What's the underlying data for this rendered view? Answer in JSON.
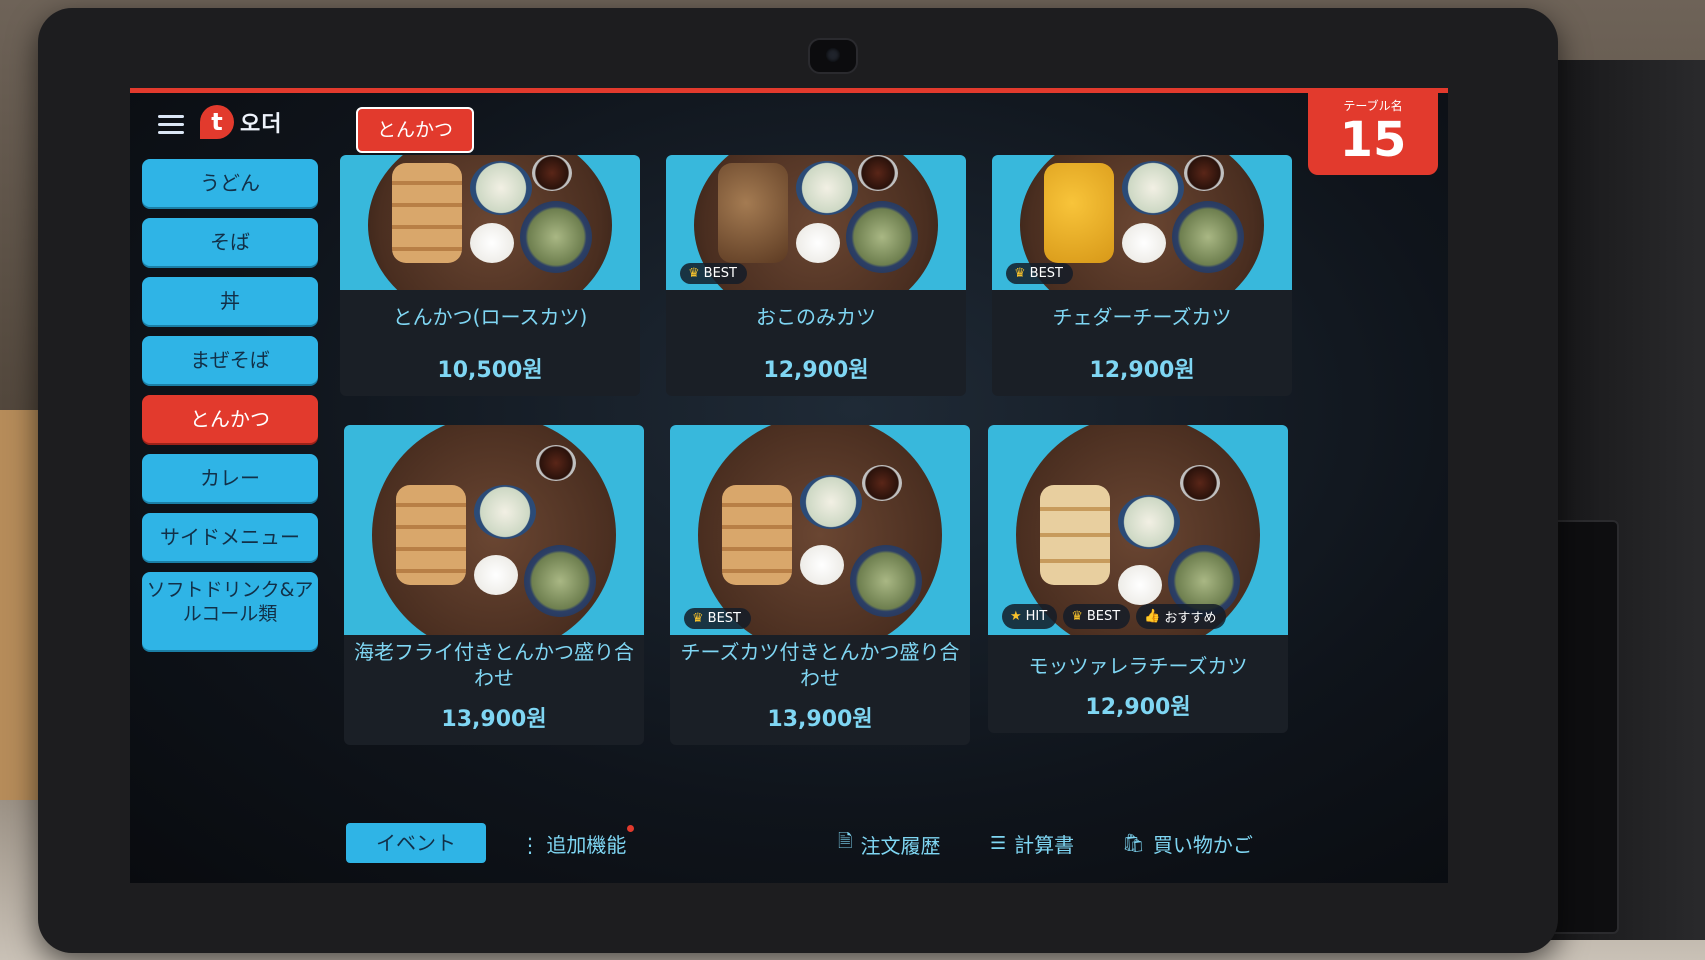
{
  "app": {
    "logo_letter": "t",
    "logo_text": "오더",
    "accent": "#e23a2d",
    "button_color": "#2fb4e6",
    "text_color": "#7fd6f3"
  },
  "header": {
    "category_tag": "とんかつ",
    "table_label": "テーブル名",
    "table_number": "15"
  },
  "sidebar": {
    "items": [
      {
        "label": "うどん",
        "active": false
      },
      {
        "label": "そば",
        "active": false
      },
      {
        "label": "丼",
        "active": false
      },
      {
        "label": "まぜそば",
        "active": false
      },
      {
        "label": "とんかつ",
        "active": true
      },
      {
        "label": "カレー",
        "active": false
      },
      {
        "label": "サイドメニュー",
        "active": false
      },
      {
        "label": "ソフトドリンク&アルコール類",
        "active": false
      }
    ]
  },
  "menu": {
    "items": [
      {
        "name": "とんかつ(ロースカツ)",
        "price": "10,500원",
        "badges": []
      },
      {
        "name": "おこのみカツ",
        "price": "12,900원",
        "badges": [
          "BEST"
        ]
      },
      {
        "name": "チェダーチーズカツ",
        "price": "12,900원",
        "badges": [
          "BEST"
        ]
      },
      {
        "name": "海老フライ付きとんかつ盛り合わせ",
        "price": "13,900원",
        "badges": []
      },
      {
        "name": "チーズカツ付きとんかつ盛り合わせ",
        "price": "13,900원",
        "badges": [
          "BEST"
        ]
      },
      {
        "name": "モッツァレラチーズカツ",
        "price": "12,900원",
        "badges": [
          "HIT",
          "BEST",
          "おすすめ"
        ]
      }
    ]
  },
  "bottom_bar": {
    "event": "イベント",
    "extra": "追加機能",
    "order_history": "注文履歴",
    "bill": "計算書",
    "cart": "買い物かご"
  },
  "icons": {
    "menu": "hamburger-menu-icon",
    "best": "crown-icon",
    "hit": "star-icon",
    "recommend": "thumbs-up-icon",
    "order_history": "document-icon",
    "bill": "receipt-icon",
    "cart": "shopping-bag-icon",
    "extra": "vertical-dots-icon"
  }
}
